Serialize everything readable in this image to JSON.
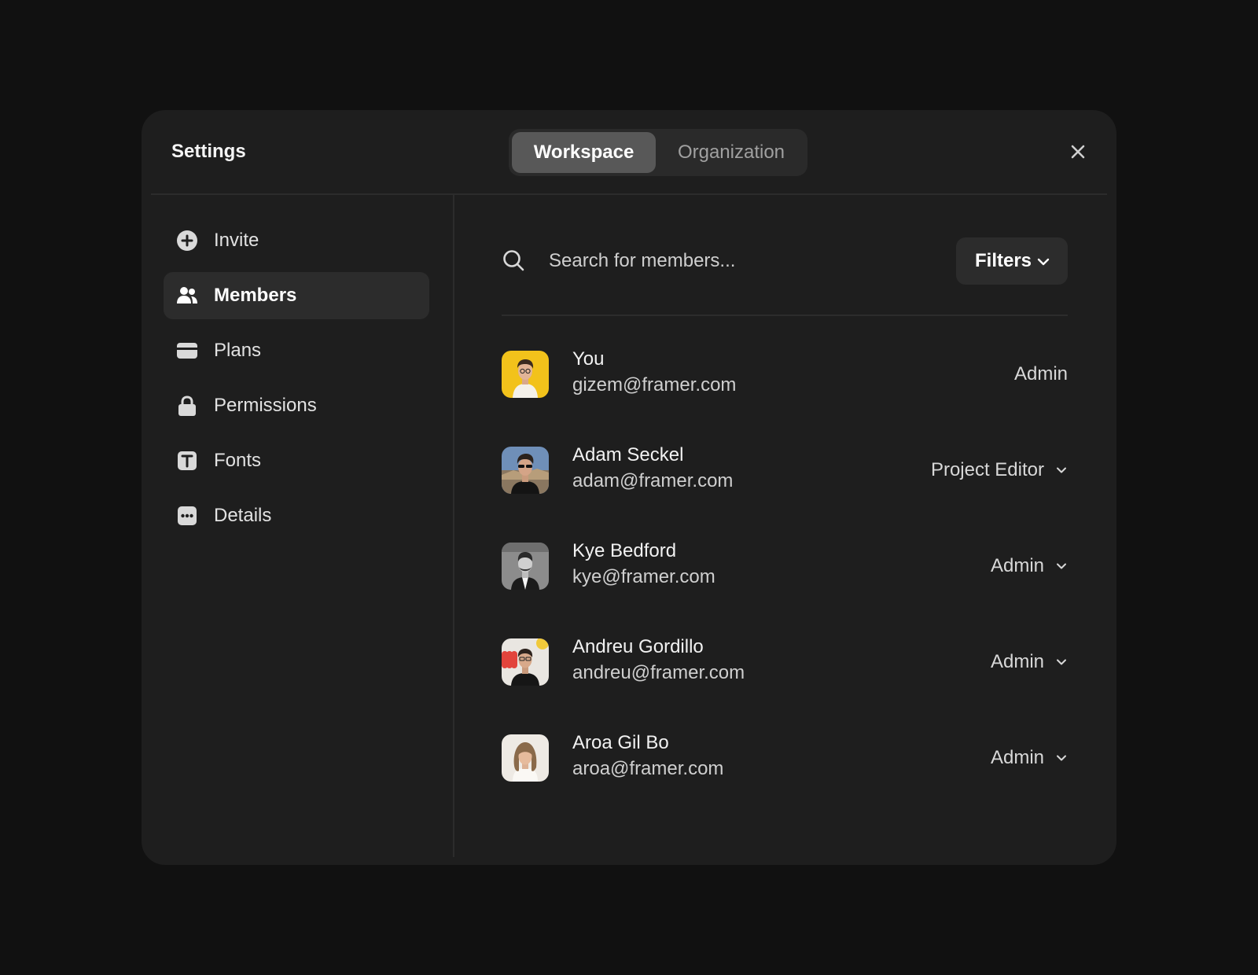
{
  "header": {
    "title": "Settings",
    "tabs": [
      {
        "label": "Workspace",
        "active": true
      },
      {
        "label": "Organization",
        "active": false
      }
    ]
  },
  "sidebar": {
    "items": [
      {
        "label": "Invite",
        "icon": "plus-circle-icon",
        "active": false
      },
      {
        "label": "Members",
        "icon": "users-icon",
        "active": true
      },
      {
        "label": "Plans",
        "icon": "credit-card-icon",
        "active": false
      },
      {
        "label": "Permissions",
        "icon": "lock-icon",
        "active": false
      },
      {
        "label": "Fonts",
        "icon": "text-t-icon",
        "active": false
      },
      {
        "label": "Details",
        "icon": "more-dots-icon",
        "active": false
      }
    ]
  },
  "search": {
    "placeholder": "Search for members...",
    "value": ""
  },
  "filters": {
    "label": "Filters"
  },
  "members": [
    {
      "name": "You",
      "email": "gizem@framer.com",
      "role": "Admin",
      "editable": false
    },
    {
      "name": "Adam Seckel",
      "email": "adam@framer.com",
      "role": "Project Editor",
      "editable": true
    },
    {
      "name": "Kye Bedford",
      "email": "kye@framer.com",
      "role": "Admin",
      "editable": true
    },
    {
      "name": "Andreu Gordillo",
      "email": "andreu@framer.com",
      "role": "Admin",
      "editable": true
    },
    {
      "name": "Aroa Gil Bo",
      "email": "aroa@framer.com",
      "role": "Admin",
      "editable": true
    }
  ],
  "colors": {
    "page_bg": "#111111",
    "modal_bg": "#1e1e1e",
    "active_bg": "#2c2c2c",
    "segment_active": "#585858"
  }
}
